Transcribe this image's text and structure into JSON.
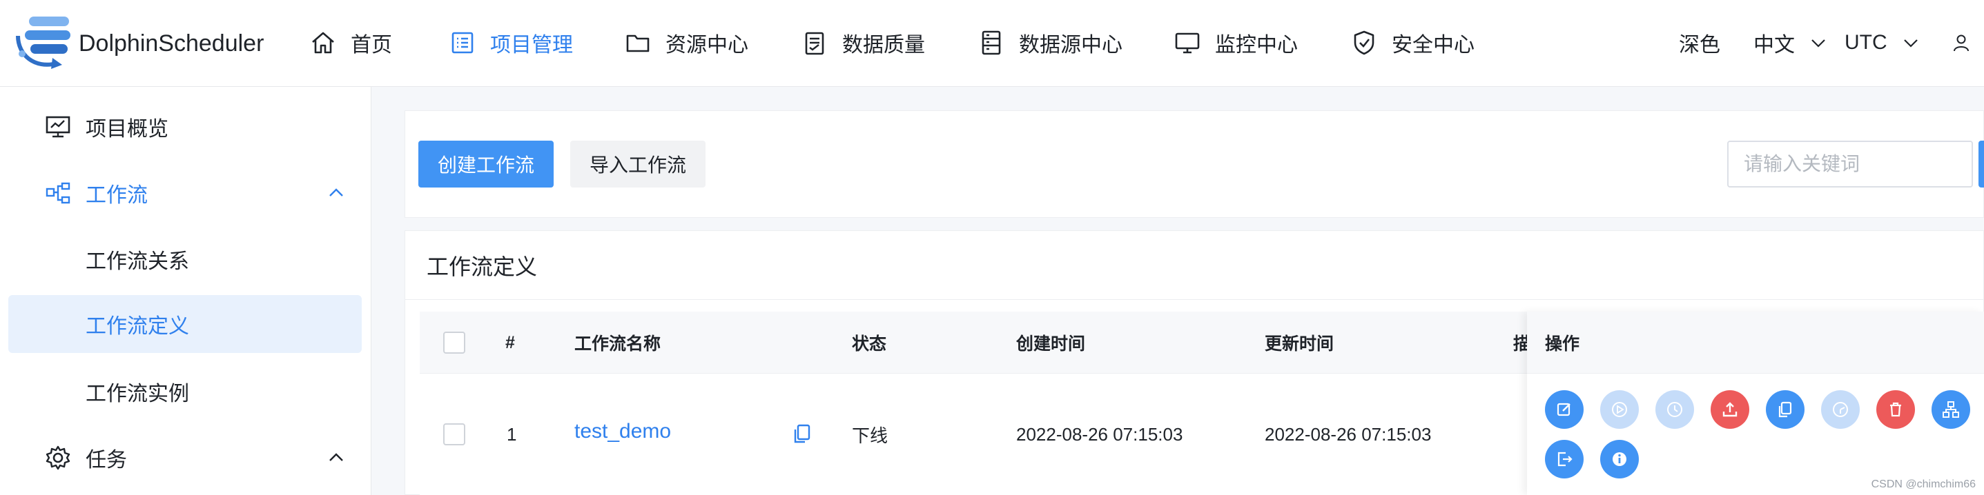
{
  "brand": {
    "name": "DolphinScheduler"
  },
  "nav": {
    "items": [
      {
        "label": "首页",
        "icon": "home-icon",
        "active": false
      },
      {
        "label": "项目管理",
        "icon": "list-icon",
        "active": true
      },
      {
        "label": "资源中心",
        "icon": "folder-icon",
        "active": false
      },
      {
        "label": "数据质量",
        "icon": "clipboard-icon",
        "active": false
      },
      {
        "label": "数据源中心",
        "icon": "server-icon",
        "active": false
      },
      {
        "label": "监控中心",
        "icon": "monitor-icon",
        "active": false
      },
      {
        "label": "安全中心",
        "icon": "shield-icon",
        "active": false
      }
    ],
    "theme_label": "深色",
    "language": "中文",
    "timezone": "UTC"
  },
  "sidebar": {
    "items": [
      {
        "label": "项目概览",
        "icon": "presentation-icon"
      },
      {
        "label": "工作流",
        "icon": "workflow-icon",
        "expanded": true
      },
      {
        "label": "工作流关系"
      },
      {
        "label": "工作流定义",
        "selected": true
      },
      {
        "label": "工作流实例"
      },
      {
        "label": "任务",
        "icon": "gear-icon",
        "expanded": true
      }
    ]
  },
  "toolbar": {
    "create_label": "创建工作流",
    "import_label": "导入工作流",
    "search_placeholder": "请输入关键词"
  },
  "table": {
    "title": "工作流定义",
    "columns": [
      "#",
      "工作流名称",
      "状态",
      "创建时间",
      "更新时间",
      "描",
      "操作"
    ],
    "rows": [
      {
        "index": "1",
        "name": "test_demo",
        "status": "下线",
        "created": "2022-08-26 07:15:03",
        "updated": "2022-08-26 07:15:03"
      }
    ],
    "actions": [
      {
        "icon": "edit-icon",
        "color": "#4194f4"
      },
      {
        "icon": "play-icon",
        "color": "#c5dcf9"
      },
      {
        "icon": "clock-icon",
        "color": "#c5dcf9"
      },
      {
        "icon": "upload-icon",
        "color": "#ed5a5a"
      },
      {
        "icon": "copy-icon",
        "color": "#4194f4"
      },
      {
        "icon": "timer-icon",
        "color": "#c5dcf9"
      },
      {
        "icon": "trash-icon",
        "color": "#ed5a5a"
      },
      {
        "icon": "tree-icon",
        "color": "#4194f4"
      },
      {
        "icon": "export-icon",
        "color": "#4194f4"
      },
      {
        "icon": "info-icon",
        "color": "#4194f4"
      }
    ]
  },
  "watermark": "CSDN @chimchim66",
  "colors": {
    "primary": "#4194f4",
    "danger": "#ed5a5a",
    "disabled": "#c5dcf9",
    "link": "#2f80ed"
  }
}
